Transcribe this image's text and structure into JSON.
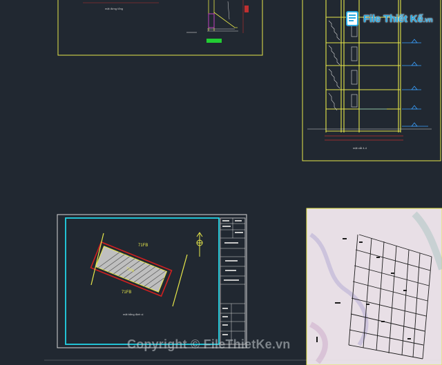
{
  "logo": {
    "text": "File Thiết Kế",
    "domain": ".vn"
  },
  "watermark": {
    "text": "Copyright © FileThietKe.vn"
  },
  "drawing_labels": {
    "site_area_top": "71FB",
    "site_area_bottom": "71FB",
    "lot_label": "71FB",
    "top_sheet_caption": "mặt đứng tổng",
    "section_caption": "mặt cắt 4-4",
    "site_plan_caption": "mặt bằng định vị"
  },
  "colors": {
    "background": "#212831",
    "sheet_yellow": "#e8e84a",
    "sheet_white": "#d9d9d9",
    "cyan_border": "#22d3e6",
    "red_line": "#d02020",
    "magenta": "#c040c0",
    "green": "#22cc33"
  }
}
